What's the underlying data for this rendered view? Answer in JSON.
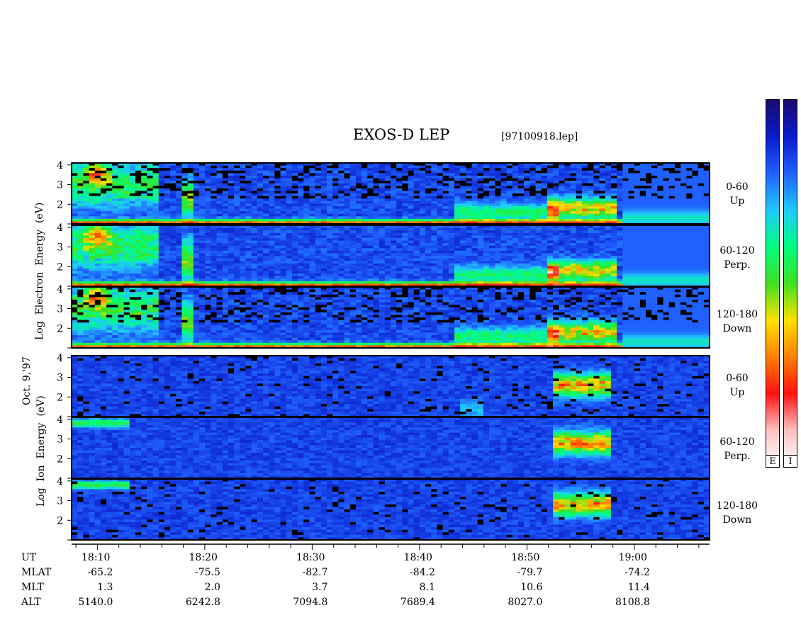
{
  "title": "EXOS-D LEP",
  "file": "[97100918.lep]",
  "date_label": "Oct. 9,'97",
  "electron_axis_label": "Log  Electron  Energy  (eV)",
  "ion_axis_label": "Log  Ion  Energy  (eV)",
  "colorbar": {
    "electron_tag": "E",
    "ion_tag": "I"
  },
  "panels": [
    {
      "group": "electron",
      "label_1": "0-60",
      "label_2": "Up"
    },
    {
      "group": "electron",
      "label_1": "60-120",
      "label_2": "Perp."
    },
    {
      "group": "electron",
      "label_1": "120-180",
      "label_2": "Down"
    },
    {
      "group": "ion",
      "label_1": "0-60",
      "label_2": "Up"
    },
    {
      "group": "ion",
      "label_1": "60-120",
      "label_2": "Perp."
    },
    {
      "group": "ion",
      "label_1": "120-180",
      "label_2": "Down"
    }
  ],
  "rows": [
    {
      "name": "UT",
      "values": [
        "18:10",
        "18:20",
        "18:30",
        "18:40",
        "18:50",
        "19:00"
      ]
    },
    {
      "name": "MLAT",
      "values": [
        "-65.2",
        "-75.5",
        "-82.7",
        "-84.2",
        "-79.7",
        "-74.2"
      ]
    },
    {
      "name": "MLT",
      "values": [
        "1.3",
        "2.0",
        "3.7",
        "8.1",
        "10.6",
        "11.4"
      ]
    },
    {
      "name": "ALT",
      "values": [
        "5140.0",
        "6242.8",
        "7094.8",
        "7689.4",
        "8027.0",
        "8108.8"
      ]
    }
  ],
  "chart_data": {
    "type": "heatmap",
    "x_ticks_ut": [
      "18:10",
      "18:20",
      "18:30",
      "18:40",
      "18:50",
      "19:00"
    ],
    "x_range_minutes_after_18h": [
      7.6,
      67.0
    ],
    "y_ticks": [
      2,
      3,
      4
    ],
    "y_range_log_ev": [
      1.0,
      4.1
    ],
    "colorscale": [
      "#1a0a6e",
      "#0a1cc8",
      "#2060ff",
      "#20c8ff",
      "#00ff80",
      "#40e020",
      "#ffe000",
      "#ff8000",
      "#ff1010",
      "#ffc0c0",
      "#ffffff"
    ],
    "series": [
      {
        "name": "Electron 0-60 Up"
      },
      {
        "name": "Electron 60-120 Perp."
      },
      {
        "name": "Electron 120-180 Down"
      },
      {
        "name": "Ion 0-60 Up"
      },
      {
        "name": "Ion 60-120 Perp."
      },
      {
        "name": "Ion 120-180 Down"
      }
    ]
  }
}
